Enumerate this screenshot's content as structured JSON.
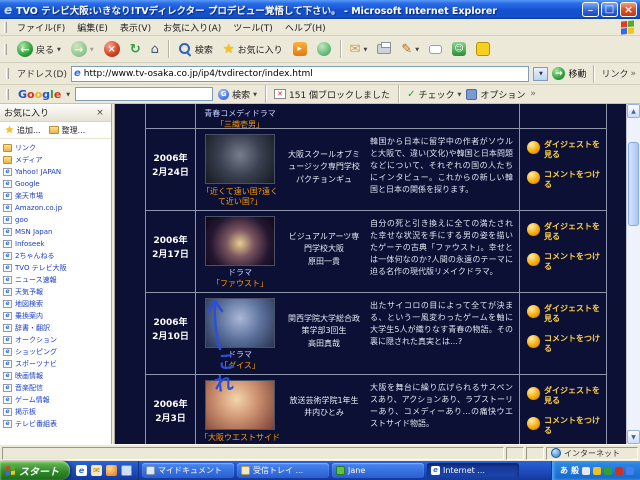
{
  "window": {
    "title": "TVO テレビ大阪:いきなり!TVディレクター プロデビュー覚悟して下さい。 - Microsoft Internet Explorer"
  },
  "menu": {
    "items": [
      "ファイル(F)",
      "編集(E)",
      "表示(V)",
      "お気に入り(A)",
      "ツール(T)",
      "ヘルプ(H)"
    ]
  },
  "toolbar": {
    "back": "戻る",
    "search": "検索",
    "favorites": "お気に入り"
  },
  "address": {
    "label": "アドレス(D)",
    "url": "http://www.tv-osaka.co.jp/ip4/tvdirector/index.html",
    "go": "移動",
    "links": "リンク"
  },
  "google": {
    "logo_letters": [
      {
        "ch": "G",
        "cls": "gc-b"
      },
      {
        "ch": "o",
        "cls": "gc-r"
      },
      {
        "ch": "o",
        "cls": "gc-y"
      },
      {
        "ch": "g",
        "cls": "gc-b"
      },
      {
        "ch": "l",
        "cls": "gc-g"
      },
      {
        "ch": "e",
        "cls": "gc-r"
      }
    ],
    "search": "検索",
    "blocked": "151 個ブロックしました",
    "check": "チェック",
    "options": "オプション"
  },
  "favorites_panel": {
    "title": "お気に入り",
    "add": "追加...",
    "organize": "整理...",
    "items": [
      {
        "type": "folder",
        "label": "リンク"
      },
      {
        "type": "folder",
        "label": "メディア"
      },
      {
        "type": "page",
        "label": "Yahoo! JAPAN"
      },
      {
        "type": "page",
        "label": "Google"
      },
      {
        "type": "page",
        "label": "楽天市場"
      },
      {
        "type": "page",
        "label": "Amazon.co.jp"
      },
      {
        "type": "page",
        "label": "goo"
      },
      {
        "type": "page",
        "label": "MSN Japan"
      },
      {
        "type": "page",
        "label": "Infoseek"
      },
      {
        "type": "page",
        "label": "2ちゃんねる"
      },
      {
        "type": "page",
        "label": "TVO テレビ大阪"
      },
      {
        "type": "page",
        "label": "ニュース速報"
      },
      {
        "type": "page",
        "label": "天気予報"
      },
      {
        "type": "page",
        "label": "地図検索"
      },
      {
        "type": "page",
        "label": "乗換案内"
      },
      {
        "type": "page",
        "label": "辞書・翻訳"
      },
      {
        "type": "page",
        "label": "オークション"
      },
      {
        "type": "page",
        "label": "ショッピング"
      },
      {
        "type": "page",
        "label": "スポーツナビ"
      },
      {
        "type": "page",
        "label": "映画情報"
      },
      {
        "type": "page",
        "label": "音楽配信"
      },
      {
        "type": "page",
        "label": "ゲーム情報"
      },
      {
        "type": "page",
        "label": "掲示板"
      },
      {
        "type": "page",
        "label": "テレビ番組表"
      }
    ]
  },
  "page": {
    "partial": {
      "genre": "青春コメディドラマ",
      "caption": "「三織壱男」"
    },
    "digest_label": "ダイジェストを見る",
    "comment_label": "コメントをつける",
    "rows": [
      {
        "thumb": "t1",
        "date_year": "2006年",
        "date_day": "2月24日",
        "genre": "",
        "caption": "「近くて遠い国?遠くて近い国?」",
        "school": "大阪スクールオブミュージック専門学校",
        "name": "パクチョンギュ",
        "desc": "韓国から日本に留学中の作者がソウルと大阪で、違い(文化)や韓国と日本問題などについて、それぞれの国の人たちにインタビュー。これからの新しい韓国と日本の関係を探ります。"
      },
      {
        "thumb": "t2",
        "date_year": "2006年",
        "date_day": "2月17日",
        "genre": "ドラマ",
        "caption": "「ファウスト」",
        "school": "ビジュアルアーツ専門学校大阪",
        "name": "原田一貴",
        "desc": "自分の死と引き換えに全ての満たされた幸せな状況を手にする男の姿を描いたゲーテの古典「ファウスト」。幸せとは一体何なのか?人間の永遠のテーマに迫る名作の現代版リメイクドラマ。"
      },
      {
        "thumb": "t3",
        "date_year": "2006年",
        "date_day": "2月10日",
        "genre": "ドラマ",
        "caption": "「ダイス」",
        "school": "関西学院大学総合政策学部3回生",
        "name": "高田真哉",
        "desc": "出たサイコロの目によって全てが決まる、という一風変わったゲームを軸に大学生5人が織りなす青春の物語。その裏に隠された真実とは…?"
      },
      {
        "thumb": "t4",
        "date_year": "2006年",
        "date_day": "2月3日",
        "genre": "",
        "caption": "「大阪ウエストサイドストーリー」",
        "school": "放送芸術学院1年生",
        "name": "井内ひとみ",
        "desc": "大阪を舞台に繰り広げられるサスペンスあり、アクションあり、ラブストーリーあり、コメディーあり…の痛快ウエストサイド物語。"
      }
    ]
  },
  "annotation": {
    "char1": "こ",
    "char2": "れ"
  },
  "status": {
    "zone": "インターネット"
  },
  "taskbar": {
    "start": "スタート",
    "ime1": "あ",
    "ime2": "般",
    "tasks": [
      {
        "icon": "doc",
        "label": "マイドキュメント",
        "state": "normal"
      },
      {
        "icon": "mail",
        "label": "受信トレイ ...",
        "state": "normal"
      },
      {
        "icon": "jane",
        "label": "Jane",
        "state": "normal"
      },
      {
        "icon": "ie",
        "label": "Internet ...",
        "state": "active"
      }
    ]
  }
}
